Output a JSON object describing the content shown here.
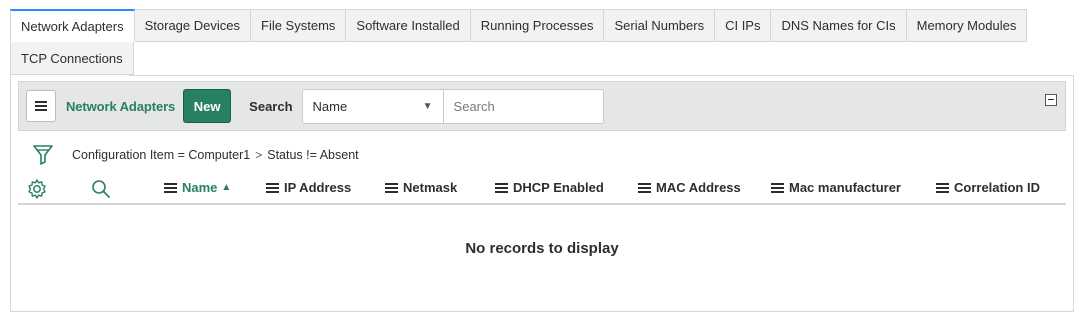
{
  "tabs": {
    "row1": [
      {
        "label": "Network Adapters",
        "active": true
      },
      {
        "label": "Storage Devices"
      },
      {
        "label": "File Systems"
      },
      {
        "label": "Software Installed"
      },
      {
        "label": "Running Processes"
      },
      {
        "label": "Serial Numbers"
      },
      {
        "label": "CI IPs"
      },
      {
        "label": "DNS Names for CIs"
      },
      {
        "label": "Memory Modules"
      }
    ],
    "row2": [
      {
        "label": "TCP Connections"
      }
    ]
  },
  "toolbar": {
    "list_title": "Network Adapters",
    "new_label": "New",
    "search_label": "Search",
    "search_field": "Name",
    "search_placeholder": "Search"
  },
  "filter": {
    "condition1": "Configuration Item = Computer1",
    "separator": ">",
    "condition2": "Status != Absent"
  },
  "columns": [
    {
      "label": "Name",
      "sorted": "asc"
    },
    {
      "label": "IP Address"
    },
    {
      "label": "Netmask"
    },
    {
      "label": "DHCP Enabled"
    },
    {
      "label": "MAC Address"
    },
    {
      "label": "Mac manufacturer"
    },
    {
      "label": "Correlation ID"
    }
  ],
  "empty_message": "No records to display",
  "colors": {
    "accent_green": "#278060",
    "tab_active_border": "#278efc"
  }
}
